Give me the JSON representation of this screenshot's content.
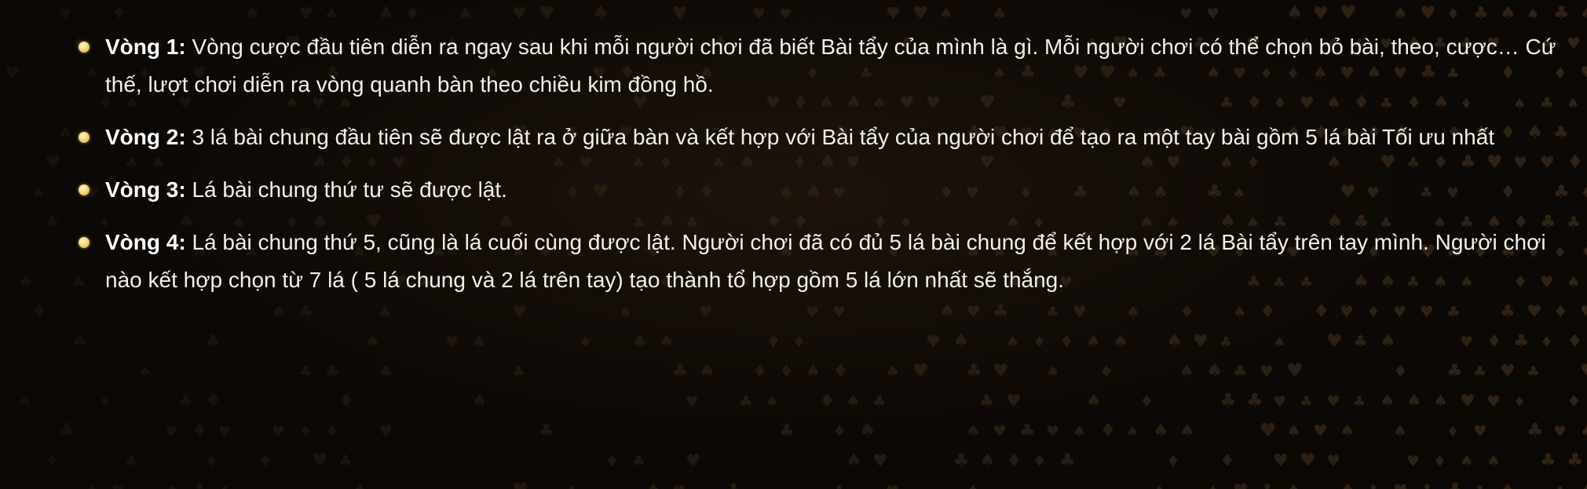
{
  "rounds": [
    {
      "label": "Vòng 1:",
      "text": " Vòng cược đầu tiên diễn ra ngay sau khi mỗi người chơi đã biết Bài tẩy của mình là gì. Mỗi người chơi có thể chọn bỏ bài, theo, cược… Cứ thế, lượt chơi diễn ra vòng quanh bàn theo chiều kim đồng hồ."
    },
    {
      "label": "Vòng 2:",
      "text": " 3 lá bài chung đầu tiên sẽ được lật ra ở giữa bàn và kết hợp với Bài tẩy của người chơi để tạo ra một tay bài gồm 5 lá bài Tối ưu nhất"
    },
    {
      "label": "Vòng 3:",
      "text": " Lá bài chung thứ tư sẽ được lật."
    },
    {
      "label": "Vòng 4:",
      "text": " Lá bài chung thứ 5, cũng là lá cuối cùng được lật. Người chơi đã có đủ 5 lá bài chung để kết hợp với 2 lá Bài tẩy trên tay mình. Người chơi nào kết hợp chọn từ 7 lá ( 5 lá chung và 2 lá trên tay) tạo thành tổ hợp gồm 5 lá lớn nhất sẽ thắng."
    }
  ],
  "colors": {
    "background": "#0f0a06",
    "text": "#f2efe9",
    "bullet": "#f1d77a",
    "suit_pattern": "#3a2a1a"
  },
  "icons": {
    "bullet": "round-bullet-icon",
    "pattern": "card-suit-pattern-icon"
  }
}
